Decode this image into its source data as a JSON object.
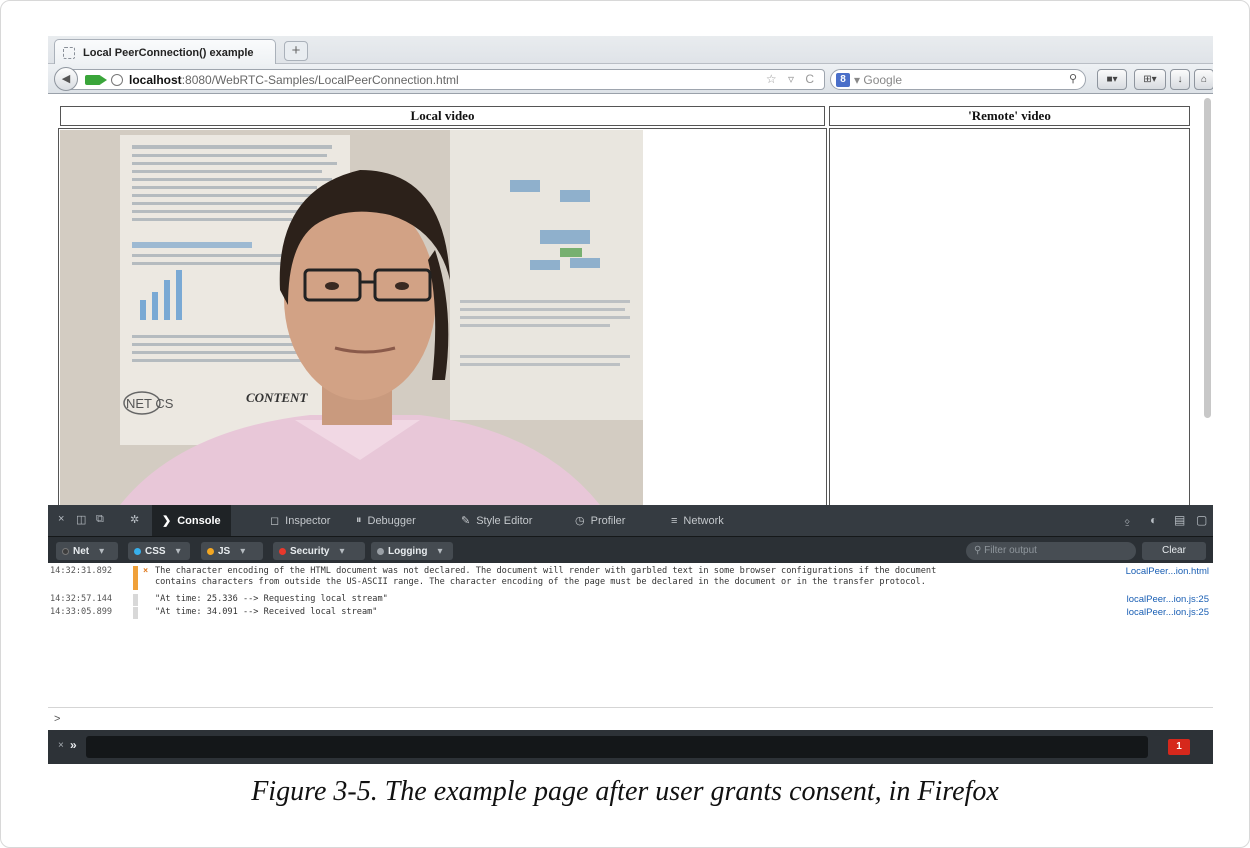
{
  "browser": {
    "tab_title": "Local PeerConnection() example",
    "new_tab": "+",
    "url_host": "localhost",
    "url_rest": ":8080/WebRTC-Samples/LocalPeerConnection.html",
    "url_controls": "☆ ▿ C",
    "search_engine": "8",
    "search_placeholder": "▾ Google",
    "search_icon": "⚲"
  },
  "page": {
    "local_header": "Local video",
    "remote_header": "'Remote' video"
  },
  "devtools": {
    "tabs": [
      {
        "label": "Console",
        "icon": "chevron-right-icon"
      },
      {
        "label": "Inspector",
        "icon": "inspector-icon"
      },
      {
        "label": "Debugger",
        "icon": "debugger-icon"
      },
      {
        "label": "Style Editor",
        "icon": "pencil-icon"
      },
      {
        "label": "Profiler",
        "icon": "clock-icon"
      },
      {
        "label": "Network",
        "icon": "network-icon"
      }
    ],
    "filters": [
      {
        "label": "Net",
        "color": "#3d3d3d"
      },
      {
        "label": "CSS",
        "color": "#37b0ec"
      },
      {
        "label": "JS",
        "color": "#f3a722"
      },
      {
        "label": "Security",
        "color": "#e8382c"
      },
      {
        "label": "Logging",
        "color": "#9aa0a6"
      }
    ],
    "filter_placeholder": "⚲ Filter output",
    "clear_label": "Clear",
    "prompt": ">",
    "cmd_arrow": "»",
    "error_count": "1"
  },
  "console_rows": [
    {
      "time": "14:32:31.892",
      "message": "The character encoding of the HTML document was not declared. The document will render with garbled text in some browser configurations if the document\ncontains characters from outside the US-ASCII range. The character encoding of the page must be declared in the document or in the transfer protocol.",
      "source": "LocalPeer...ion.html",
      "level": "warning"
    },
    {
      "time": "14:32:57.144",
      "message": "\"At time: 25.336 --> Requesting local stream\"",
      "source": "localPeer...ion.js:25",
      "level": "log"
    },
    {
      "time": "14:33:05.899",
      "message": "\"At time: 34.091 --> Received local stream\"",
      "source": "localPeer...ion.js:25",
      "level": "log"
    }
  ],
  "caption": "Figure 3-5. The example page after user grants consent, in Firefox",
  "video_logos": {
    "left": "NET CS",
    "right": "CONTENT"
  }
}
